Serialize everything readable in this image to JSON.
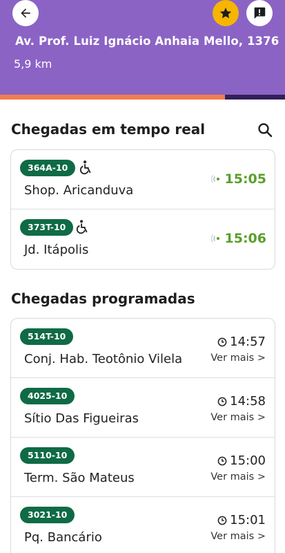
{
  "header": {
    "address": "Av. Prof. Luiz Ignácio Anhaia Mello, 1376",
    "distance": "5,9 km",
    "progress_fraction": 0.79,
    "colors": {
      "background": "#8b63c5",
      "progress": "#f07f4e",
      "track": "#32205a",
      "favorite": "#f6b500"
    },
    "buttons": {
      "back_icon": "arrow-left-icon",
      "favorite_icon": "star-icon",
      "report_icon": "alert-message-icon"
    }
  },
  "realtime": {
    "title": "Chegadas em tempo real",
    "search_icon": "search-icon",
    "items": [
      {
        "line": "364A-10",
        "destination": "Shop. Aricanduva",
        "time": "15:05",
        "accessible": true
      },
      {
        "line": "373T-10",
        "destination": "Jd. Itápolis",
        "time": "15:06",
        "accessible": true
      }
    ]
  },
  "scheduled": {
    "title": "Chegadas programadas",
    "more_label": "Ver mais >",
    "items": [
      {
        "line": "514T-10",
        "destination": "Conj. Hab. Teotônio Vilela",
        "time": "14:57"
      },
      {
        "line": "4025-10",
        "destination": "Sítio Das Figueiras",
        "time": "14:58"
      },
      {
        "line": "5110-10",
        "destination": "Term. São Mateus",
        "time": "15:00"
      },
      {
        "line": "3021-10",
        "destination": "Pq. Bancário",
        "time": "15:01"
      }
    ]
  },
  "colors": {
    "badge": "#0f6b45",
    "realtime_time": "#5a9f2a"
  }
}
